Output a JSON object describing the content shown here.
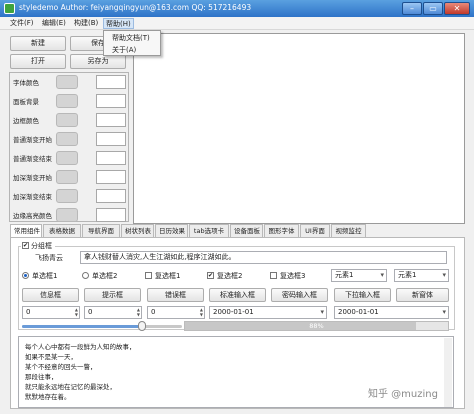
{
  "titlebar": {
    "title": "styledemo    Author: feiyangqingyun@163.com    QQ: 517216493",
    "min": "–",
    "max": "▭",
    "close": "✕"
  },
  "menubar": {
    "items": [
      "文件(F)",
      "编辑(E)",
      "构建(B)",
      "帮助(H)"
    ]
  },
  "help_menu": {
    "items": [
      "帮助文档(T)",
      "关于(A)"
    ]
  },
  "left_buttons": {
    "new": "新建",
    "save": "保存",
    "open": "打开",
    "save_as": "另存为"
  },
  "color_settings": {
    "items": [
      "字体颜色",
      "面板背景",
      "边框颜色",
      "普通渐变开始",
      "普通渐变结束",
      "加深渐变开始",
      "加深渐变结束",
      "边缘高亮颜色"
    ],
    "swatch_color": "#d4d4d4"
  },
  "tabs": {
    "items": [
      "常用组件",
      "表格数据",
      "导航界面",
      "树状列表",
      "日历效果",
      "tab选项卡",
      "设备面板",
      "图形字体",
      "UI界面",
      "视频监控"
    ],
    "active_index": 0
  },
  "content": {
    "group_label": "分组框",
    "group_checked": true,
    "line_label": "飞扬青云",
    "line_value": "拿人钱财替人消灾,人生江湖如此,程序江湖如此。",
    "radios": [
      "单选框1",
      "单选框2"
    ],
    "radio_selected": 0,
    "checkboxes": [
      {
        "label": "复选框1",
        "checked": false
      },
      {
        "label": "复选框2",
        "checked": true
      },
      {
        "label": "复选框3",
        "checked": false
      }
    ],
    "combo1": "元素1",
    "combo2": "元素1",
    "buttons": [
      "信息框",
      "提示框",
      "错误框",
      "标准输入框",
      "密码输入框",
      "下拉输入框",
      "新窗体"
    ],
    "spin1": "0",
    "spin2": "0",
    "spin3": "0",
    "date1": "2000-01-01",
    "date2": "2000-01-01",
    "slider_value_percent": 75,
    "progress_value_percent": 88,
    "progress_label": "88%",
    "poem_lines": [
      "每个人心中都有一段鲜为人知的故事，",
      "如果不是某一天，",
      "某个不经意的回头一瞥，",
      "那段往事，",
      "就只能永远地在记忆的最深处，",
      "默默地存在着。"
    ]
  },
  "watermark": "知乎 @muzing"
}
